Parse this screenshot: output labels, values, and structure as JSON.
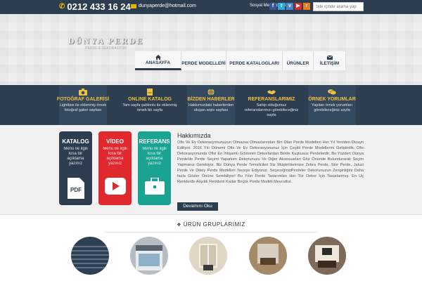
{
  "topbar": {
    "phone": "0212 433 16 24",
    "email": "dunyaperde@hotmail.com",
    "social_label": "Sosyal Medyada Biz",
    "social_icons": [
      "facebook-icon",
      "twitter-icon",
      "vimeo-icon",
      "youtube-icon",
      "rss-icon"
    ],
    "search_placeholder": "Site içinde arama yap"
  },
  "logo": {
    "title": "DÜNYA PERDE",
    "subtitle": "PERDE & DEKORASYON"
  },
  "nav": [
    {
      "label": "ANASAYFA",
      "icon": "home-icon",
      "active": true
    },
    {
      "label": "PERDE MODELLERİ",
      "icon": "grid-icon",
      "active": false
    },
    {
      "label": "PERDE KATALOGLARI",
      "icon": "chevron-down-icon",
      "active": false
    },
    {
      "label": "ÜRÜNLER",
      "icon": "chevron-down-icon",
      "active": false
    },
    {
      "label": "İLETİŞİM",
      "icon": "mail-icon",
      "active": false
    }
  ],
  "features": [
    {
      "title": "FOTOĞRAF GALERİSİ",
      "desc": "Lightbox ile eklenmiş örnek fotoğraf galeri sayfası",
      "icon": "camera-icon"
    },
    {
      "title": "ONLINE KATALOG",
      "desc": "Tam sayfa şablonlu ile eklenmiş örnek bir sayfa",
      "icon": "pdf-icon"
    },
    {
      "title": "BİZDEN HABERLER",
      "desc": "Hakkımızdaki haberlerden oluşan arşiv sayfası",
      "icon": "globe-icon"
    },
    {
      "title": "REFERANSLARIMIZ",
      "desc": "Sahip olduğumuz referanslarımızı görebileceğiniz sayfa",
      "icon": "handshake-icon"
    },
    {
      "title": "ÖRNEK YORUMLAR",
      "desc": "Yapılan örnek yorumları görebileceğiniz sayfa",
      "icon": "comments-icon"
    }
  ],
  "cards": [
    {
      "title": "KATALOG",
      "desc": "Menü ile ilgili kısa bir açıklama yazınız",
      "icon": "pdf-icon",
      "color": "#2b3d4f"
    },
    {
      "title": "VİDEO",
      "desc": "Menü ile ilgili kısa bir açıklama yazınız",
      "icon": "play-icon",
      "color": "#e0282f"
    },
    {
      "title": "REFERANS",
      "desc": "Menü ile ilgili kısa bir açıklama yazınız",
      "icon": "briefcase-icon",
      "color": "#1aa391"
    }
  ],
  "about": {
    "title": "Hakkımızda",
    "text": "Ofis Ve Ev Dekorasyonunuzun Olmazsa Olmazlarından Biri Olan Perde Modelleri Her Yıl Yeniden Dizayn Ediliyor. 2016 Yılı Dönemi Ofis Ve Ev Dekorasyonunuz İçin Çeşitli Perde Modellerini Geliştirdik. Ofis Dekorasyonunda Ofisi En İhtişamlı Gösteren Dekorlardan Biride Kuşkusuz Perdelerdir. Bu Yüzden Dünya Perde'de Perde Seçimi Yaparken Dekorunuzu Ve Diğer Aksesuarları Göz Önünde Bulundurarak Seçim Yapmanız Gerekiyor. Biz Dünya Perde Temsilcileri Siz Müşterilerimize Zebra Perde, Stor Perde, Jaluzi Perde Ve Dikey Perde Modelleri Tavsiye Ediyoruz. SeçeceğinizPerdeler Dekorunuzun Zenginliğini Daha fazla Gözler Önüne Serebiliyor! Bu Yılın Perde Tasarımları Her Tür Dekor İçin Tasarlanmış. En Uç Renklerde Alışıldı Renklere Kadar Birçok Perde Modeli Mevcuttur.",
    "button_label": "Devamını Oku"
  },
  "products": {
    "title": "ÜRÜN GRUPLARIMIZ",
    "icon": "cubes-icon",
    "items": [
      "product-1",
      "product-2",
      "product-3",
      "product-4",
      "product-5"
    ]
  },
  "colors": {
    "navy": "#2c3e50",
    "accent": "#f0c040",
    "red": "#e0282f",
    "teal": "#1aa391"
  }
}
